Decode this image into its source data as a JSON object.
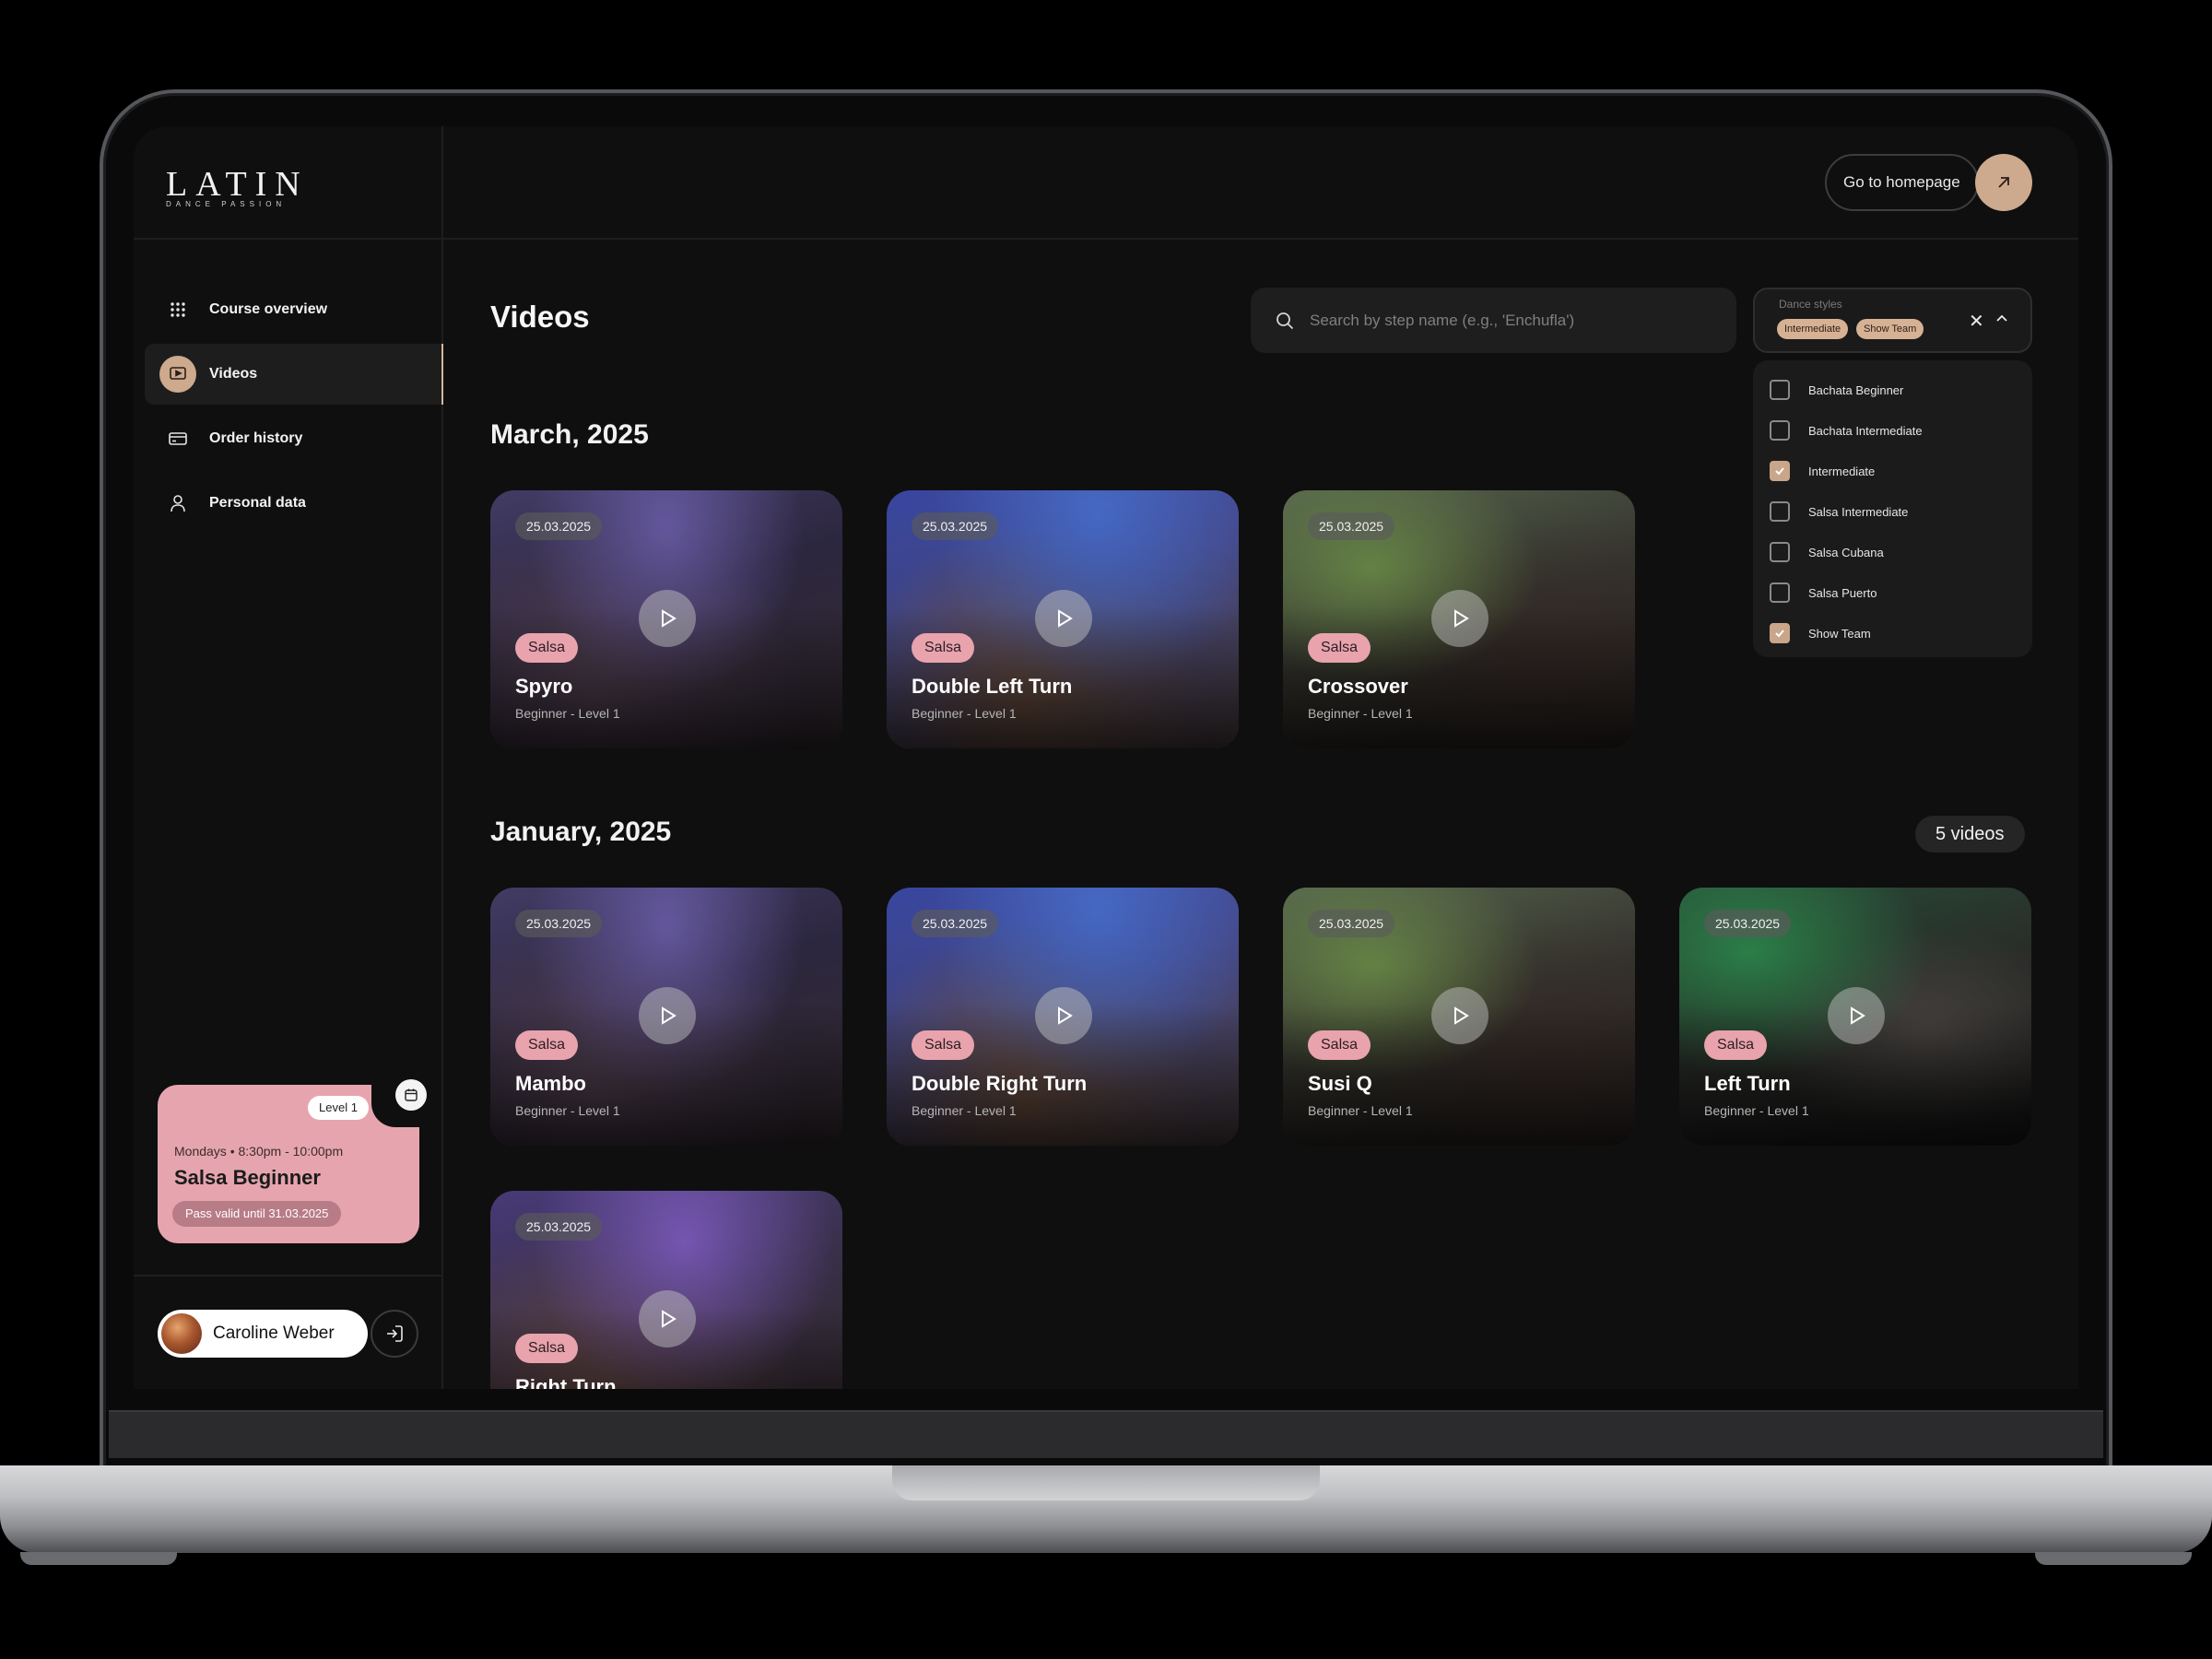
{
  "brand": {
    "name": "LATIN",
    "tagline": "DANCE PASSION"
  },
  "header": {
    "homepage_label": "Go to homepage"
  },
  "sidebar": {
    "items": [
      {
        "label": "Course overview",
        "icon": "grid-icon"
      },
      {
        "label": "Videos",
        "icon": "video-icon",
        "active": true
      },
      {
        "label": "Order history",
        "icon": "credit-card-icon"
      },
      {
        "label": "Personal data",
        "icon": "user-icon"
      }
    ],
    "course": {
      "level": "Level 1",
      "time": "Mondays • 8:30pm - 10:00pm",
      "name": "Salsa Beginner",
      "pass": "Pass valid until 31.03.2025"
    },
    "user": {
      "name": "Caroline Weber"
    }
  },
  "main": {
    "title": "Videos",
    "search": {
      "placeholder": "Search by step name (e.g., 'Enchufla')"
    },
    "filter": {
      "label": "Dance styles",
      "chips": [
        "Intermediate",
        "Show Team"
      ],
      "options": [
        {
          "label": "Bachata Beginner",
          "checked": false
        },
        {
          "label": "Bachata Intermediate",
          "checked": false
        },
        {
          "label": "Intermediate",
          "checked": true
        },
        {
          "label": "Salsa Intermediate",
          "checked": false
        },
        {
          "label": "Salsa Cubana",
          "checked": false
        },
        {
          "label": "Salsa Puerto",
          "checked": false
        },
        {
          "label": "Show Team",
          "checked": true
        }
      ]
    },
    "sections": [
      {
        "title": "March, 2025",
        "videos": [
          {
            "date": "25.03.2025",
            "style": "Salsa",
            "title": "Spyro",
            "level": "Beginner - Level 1"
          },
          {
            "date": "25.03.2025",
            "style": "Salsa",
            "title": "Double Left Turn",
            "level": "Beginner - Level 1"
          },
          {
            "date": "25.03.2025",
            "style": "Salsa",
            "title": "Crossover",
            "level": "Beginner - Level 1"
          }
        ]
      },
      {
        "title": "January, 2025",
        "count": "5 videos",
        "videos": [
          {
            "date": "25.03.2025",
            "style": "Salsa",
            "title": "Mambo",
            "level": "Beginner - Level 1"
          },
          {
            "date": "25.03.2025",
            "style": "Salsa",
            "title": "Double Right Turn",
            "level": "Beginner - Level 1"
          },
          {
            "date": "25.03.2025",
            "style": "Salsa",
            "title": "Susi Q",
            "level": "Beginner - Level 1"
          },
          {
            "date": "25.03.2025",
            "style": "Salsa",
            "title": "Left Turn",
            "level": "Beginner - Level 1"
          },
          {
            "date": "25.03.2025",
            "style": "Salsa",
            "title": "Right Turn",
            "level": ""
          }
        ]
      }
    ]
  },
  "colors": {
    "accent": "#cda98d",
    "pink": "#e8a3ad",
    "background": "#0f0f0f"
  }
}
